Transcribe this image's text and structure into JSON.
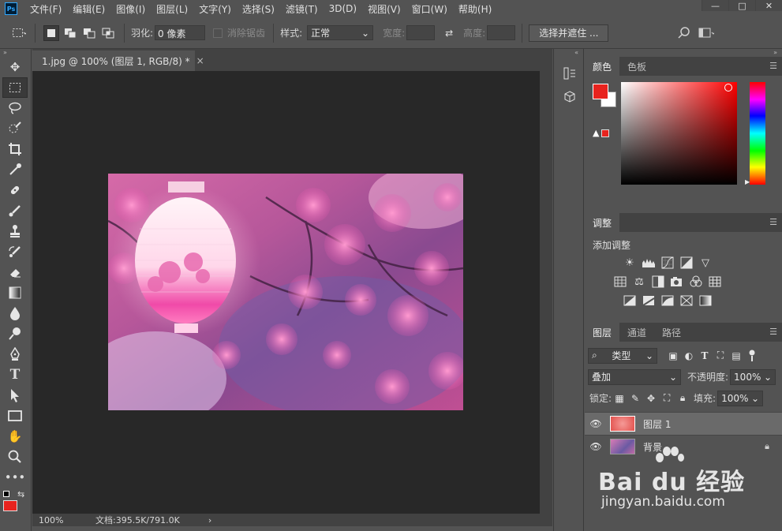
{
  "app": {
    "logo_text": "Ps"
  },
  "menubar": {
    "items": [
      "文件(F)",
      "编辑(E)",
      "图像(I)",
      "图层(L)",
      "文字(Y)",
      "选择(S)",
      "滤镜(T)",
      "3D(D)",
      "视图(V)",
      "窗口(W)",
      "帮助(H)"
    ]
  },
  "window_controls": {
    "minimize": "—",
    "maximize": "□",
    "close": "✕"
  },
  "options": {
    "feather_label": "羽化:",
    "feather_value": "0 像素",
    "antialias_label": "消除锯齿",
    "style_label": "样式:",
    "style_value": "正常",
    "width_label": "宽度:",
    "height_label": "高度:",
    "select_mask_label": "选择并遮住 ..."
  },
  "document": {
    "tab_title": "1.jpg @ 100% (图层 1, RGB/8) *",
    "tab_close": "×"
  },
  "status": {
    "zoom": "100%",
    "doc_info": "文档:395.5K/791.0K",
    "arrow": "›"
  },
  "color_panel": {
    "tabs": [
      "颜色",
      "色板"
    ],
    "foreground": "#e8231e",
    "background": "#ffffff"
  },
  "adjust_panel": {
    "tab": "调整",
    "title": "添加调整"
  },
  "layers_panel": {
    "tabs": [
      "图层",
      "通道",
      "路径"
    ],
    "filter_value": "类型",
    "blend_mode": "叠加",
    "opacity_label": "不透明度:",
    "opacity_value": "100%",
    "lock_label": "锁定:",
    "fill_label": "填充:",
    "fill_value": "100%",
    "layers": [
      {
        "name": "图层 1",
        "selected": true,
        "locked": false
      },
      {
        "name": "背景",
        "selected": false,
        "locked": true
      }
    ],
    "footer_icons": [
      "link-icon",
      "fx-icon",
      "mask-icon",
      "adjustment-icon",
      "folder-icon",
      "new-layer-icon",
      "trash-icon"
    ]
  },
  "watermark": {
    "brand": "Bai du 经验",
    "url": "jingyan.baidu.com"
  }
}
